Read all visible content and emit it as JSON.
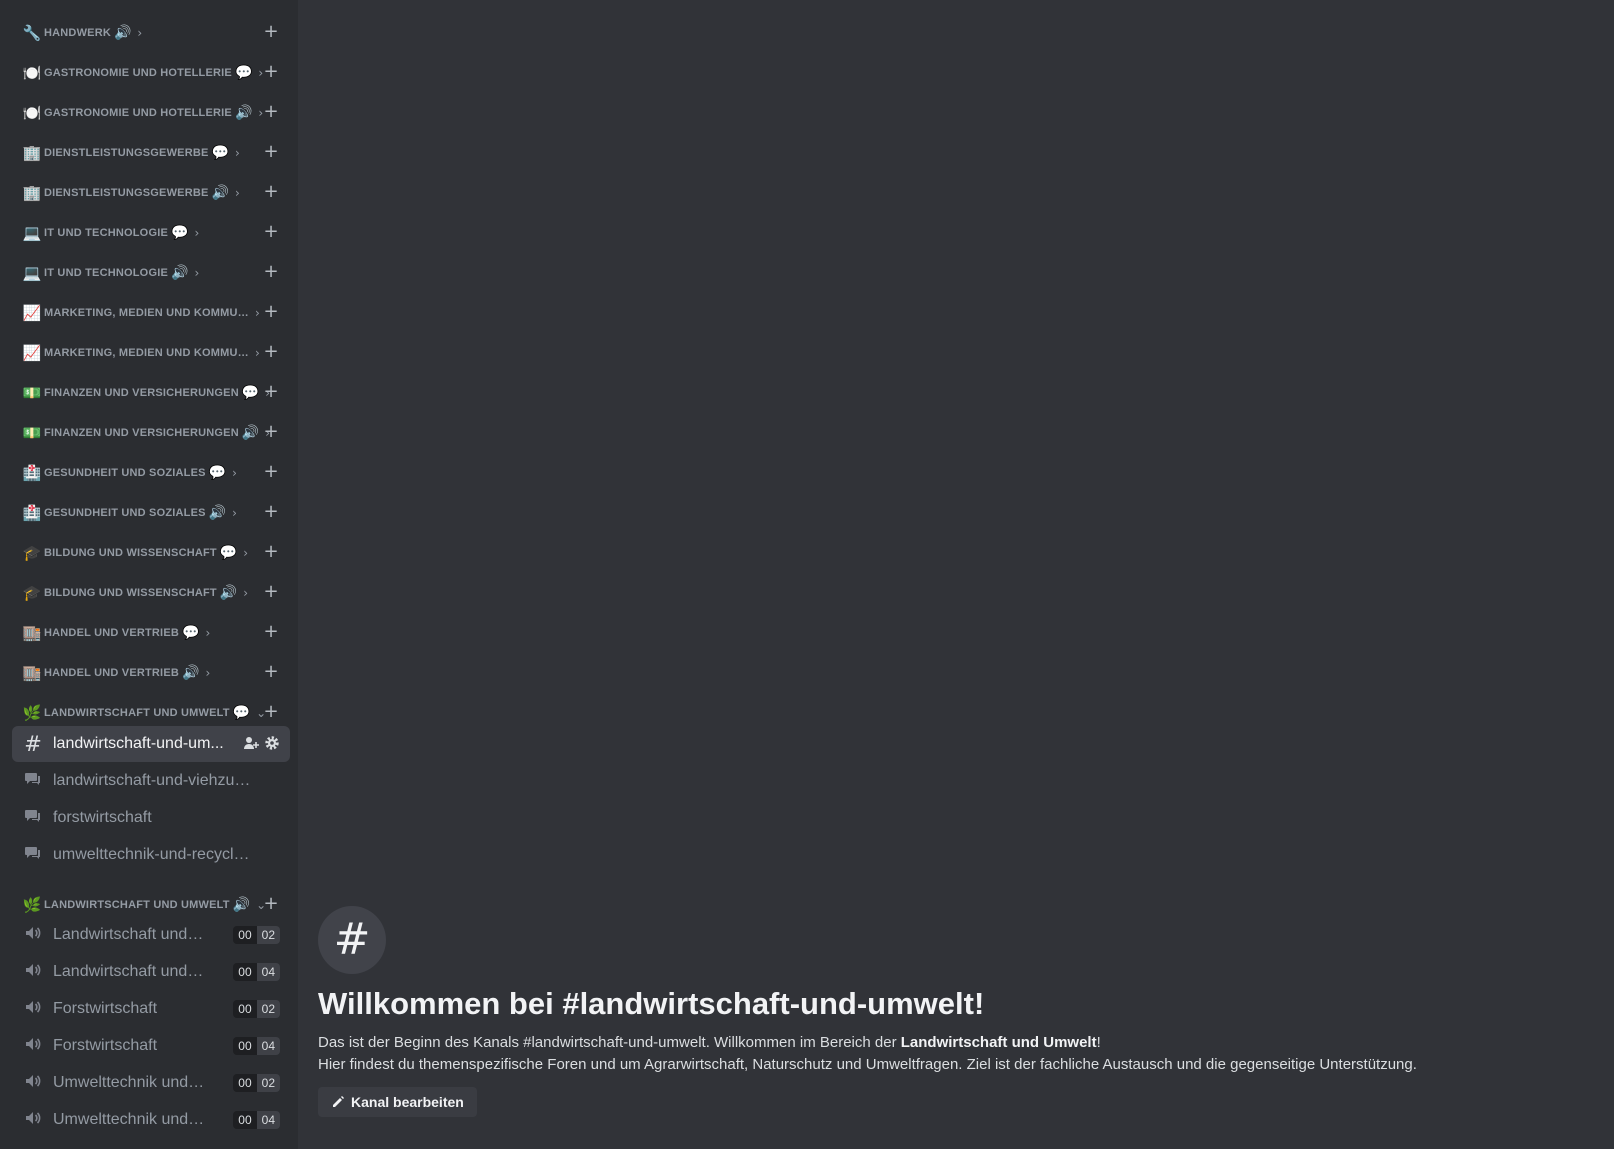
{
  "sidebar": {
    "categories": [
      {
        "emoji": "🔧",
        "label": "Handwerk",
        "kind": "🔊"
      },
      {
        "emoji": "🍽️",
        "label": "Gastronomie und Hotellerie",
        "kind": "💬"
      },
      {
        "emoji": "🍽️",
        "label": "Gastronomie und Hotellerie",
        "kind": "🔊"
      },
      {
        "emoji": "🏢",
        "label": "Dienstleistungsgewerbe",
        "kind": "💬"
      },
      {
        "emoji": "🏢",
        "label": "Dienstleistungsgewerbe",
        "kind": "🔊"
      },
      {
        "emoji": "💻",
        "label": "IT und Technologie",
        "kind": "💬"
      },
      {
        "emoji": "💻",
        "label": "IT und Technologie",
        "kind": "🔊"
      },
      {
        "emoji": "📈",
        "label": "Marketing, Medien und Kommuni...",
        "kind": ""
      },
      {
        "emoji": "📈",
        "label": "Marketing, Medien und Kommuni...",
        "kind": ""
      },
      {
        "emoji": "💵",
        "label": "Finanzen und Versicherungen",
        "kind": "💬"
      },
      {
        "emoji": "💵",
        "label": "Finanzen und Versicherungen",
        "kind": "🔊"
      },
      {
        "emoji": "🏥",
        "label": "Gesundheit und Soziales",
        "kind": "💬"
      },
      {
        "emoji": "🏥",
        "label": "Gesundheit und Soziales",
        "kind": "🔊"
      },
      {
        "emoji": "🎓",
        "label": "Bildung und Wissenschaft",
        "kind": "💬"
      },
      {
        "emoji": "🎓",
        "label": "Bildung und Wissenschaft",
        "kind": "🔊"
      },
      {
        "emoji": "🏬",
        "label": "Handel und Vertrieb",
        "kind": "💬"
      },
      {
        "emoji": "🏬",
        "label": "Handel und Vertrieb",
        "kind": "🔊"
      },
      {
        "emoji": "🌿",
        "label": "Landwirtschaft und Umwelt",
        "kind": "💬"
      },
      {
        "emoji": "🌿",
        "label": "Landwirtschaft und Umwelt",
        "kind": "🔊"
      }
    ],
    "collapsed_chevron": "›",
    "expanded_chevron": "⌄",
    "plus": "+",
    "text_channels": [
      {
        "icon": "#",
        "name": "landwirtschaft-und-um...",
        "active": true
      },
      {
        "icon": "forum-icon",
        "name": "landwirtschaft-und-viehzucht"
      },
      {
        "icon": "forum-icon",
        "name": "forstwirtschaft"
      },
      {
        "icon": "forum-icon",
        "name": "umwelttechnik-und-recycling"
      }
    ],
    "voice_channels": [
      {
        "name": "Landwirtschaft und ...",
        "users": "00",
        "limit": "02"
      },
      {
        "name": "Landwirtschaft und ...",
        "users": "00",
        "limit": "04"
      },
      {
        "name": "Forstwirtschaft",
        "users": "00",
        "limit": "02"
      },
      {
        "name": "Forstwirtschaft",
        "users": "00",
        "limit": "04"
      },
      {
        "name": "Umwelttechnik und ...",
        "users": "00",
        "limit": "02"
      },
      {
        "name": "Umwelttechnik und ...",
        "users": "00",
        "limit": "04"
      }
    ]
  },
  "main": {
    "hash": "#",
    "title": "Willkommen bei #landwirtschaft-und-umwelt!",
    "desc1_prefix": "Das ist der Beginn des Kanals #landwirtschaft-und-umwelt. Willkommen im Bereich der ",
    "desc1_bold": "Landwirtschaft und Umwelt",
    "desc1_suffix": "!",
    "desc2": "Hier findest du themenspezifische Foren und um Agrarwirtschaft, Naturschutz und Umweltfragen. Ziel ist der fachliche Austausch und die gegenseitige Unterstützung.",
    "edit_button": "Kanal bearbeiten"
  },
  "colors": {
    "background": "#313338",
    "sidebar": "#2b2d31",
    "active_channel": "#404249"
  }
}
